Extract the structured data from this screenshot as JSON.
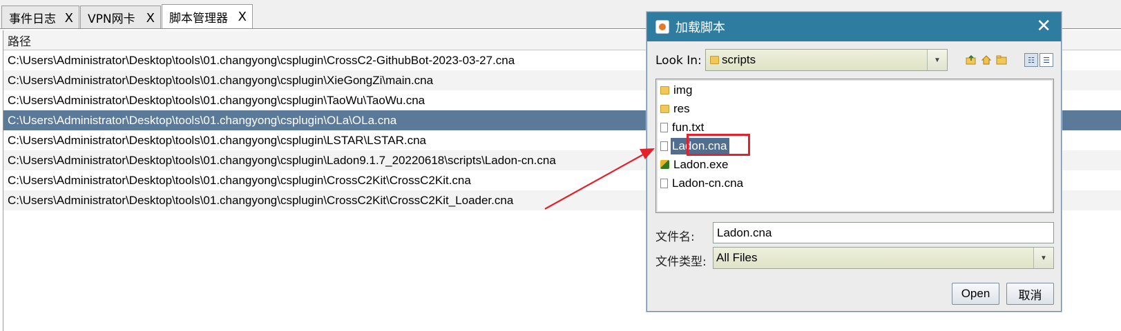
{
  "tabs": [
    {
      "label": "事件日志",
      "close": "X"
    },
    {
      "label": "VPN网卡",
      "close": "X"
    },
    {
      "label": "脚本管理器",
      "close": "X"
    }
  ],
  "table": {
    "header": "路径",
    "rows": [
      "C:\\Users\\Administrator\\Desktop\\tools\\01.changyong\\csplugin\\CrossC2-GithubBot-2023-03-27.cna",
      "C:\\Users\\Administrator\\Desktop\\tools\\01.changyong\\csplugin\\XieGongZi\\main.cna",
      "C:\\Users\\Administrator\\Desktop\\tools\\01.changyong\\csplugin\\TaoWu\\TaoWu.cna",
      "C:\\Users\\Administrator\\Desktop\\tools\\01.changyong\\csplugin\\OLa\\OLa.cna",
      "C:\\Users\\Administrator\\Desktop\\tools\\01.changyong\\csplugin\\LSTAR\\LSTAR.cna",
      "C:\\Users\\Administrator\\Desktop\\tools\\01.changyong\\csplugin\\Ladon9.1.7_20220618\\scripts\\Ladon-cn.cna",
      "C:\\Users\\Administrator\\Desktop\\tools\\01.changyong\\csplugin\\CrossC2Kit\\CrossC2Kit.cna",
      "C:\\Users\\Administrator\\Desktop\\tools\\01.changyong\\csplugin\\CrossC2Kit\\CrossC2Kit_Loader.cna"
    ]
  },
  "dialog": {
    "title": "加载脚本",
    "close": "✕",
    "look_in_label": "Look In:",
    "look_in_value": "scripts",
    "files": [
      "img",
      "res",
      "fun.txt",
      "Ladon.cna",
      "Ladon.exe",
      "Ladon-cn.cna"
    ],
    "filename_label": "文件名:",
    "filename_value": "Ladon.cna",
    "filetype_label": "文件类型:",
    "filetype_value": "All Files",
    "open_label": "Open",
    "cancel_label": "取消"
  },
  "colors": {
    "titlebar": "#2e7ca0",
    "selection": "#5b7a9a",
    "annotation": "#e3212a"
  }
}
